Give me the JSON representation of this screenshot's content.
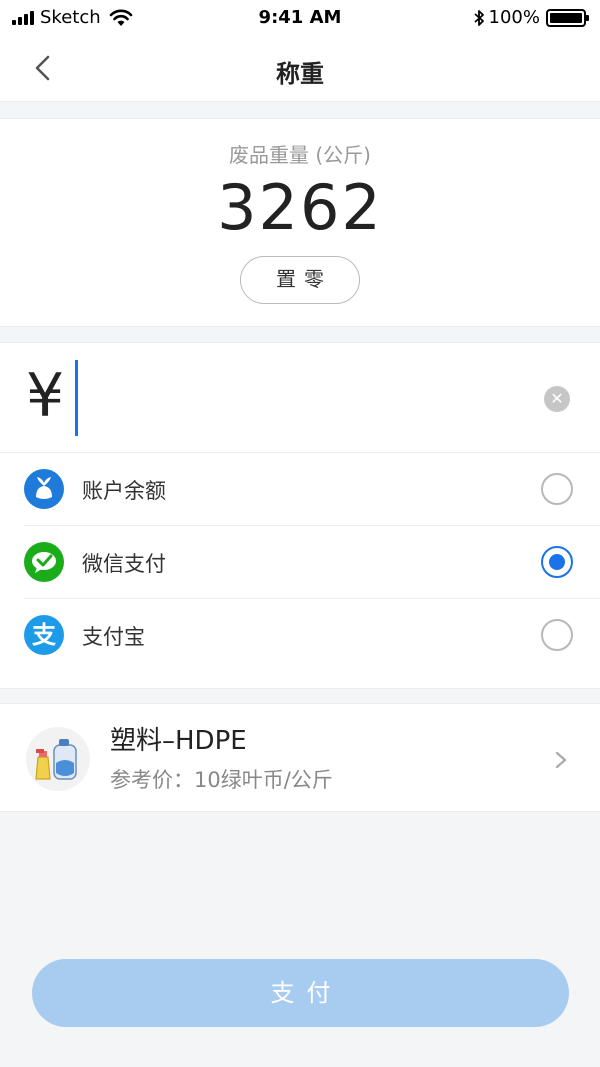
{
  "status_bar": {
    "carrier": "Sketch",
    "time": "9:41 AM",
    "battery": "100%",
    "battery_level": 1.0,
    "icons": [
      "signal-icon",
      "wifi-icon",
      "bluetooth-icon",
      "battery-icon"
    ]
  },
  "nav": {
    "title": "称重",
    "back_icon": "chevron-left-icon"
  },
  "weight": {
    "label": "废品重量 (公斤)",
    "value": "3262",
    "zero_button": "置零"
  },
  "amount": {
    "currency_symbol": "¥",
    "value": "",
    "placeholder": "",
    "clear_icon": "clear-icon"
  },
  "payment_methods": [
    {
      "label": "账户余额",
      "icon": "balance-icon",
      "selected": false
    },
    {
      "label": "微信支付",
      "icon": "wechat-pay-icon",
      "selected": true
    },
    {
      "label": "支付宝",
      "icon": "alipay-icon",
      "icon_glyph": "支",
      "selected": false
    }
  ],
  "product": {
    "name": "塑料–HDPE",
    "price": "参考价：10绿叶币/公斤",
    "icon": "plastic-bottles-icon"
  },
  "pay_button": "支付",
  "colors": {
    "accent": "#1a73e8",
    "pay_button_disabled": "#a8ccf0",
    "wechat_green": "#1aad19",
    "alipay_blue": "#1e9be8",
    "balance_blue": "#1e7bd9"
  }
}
